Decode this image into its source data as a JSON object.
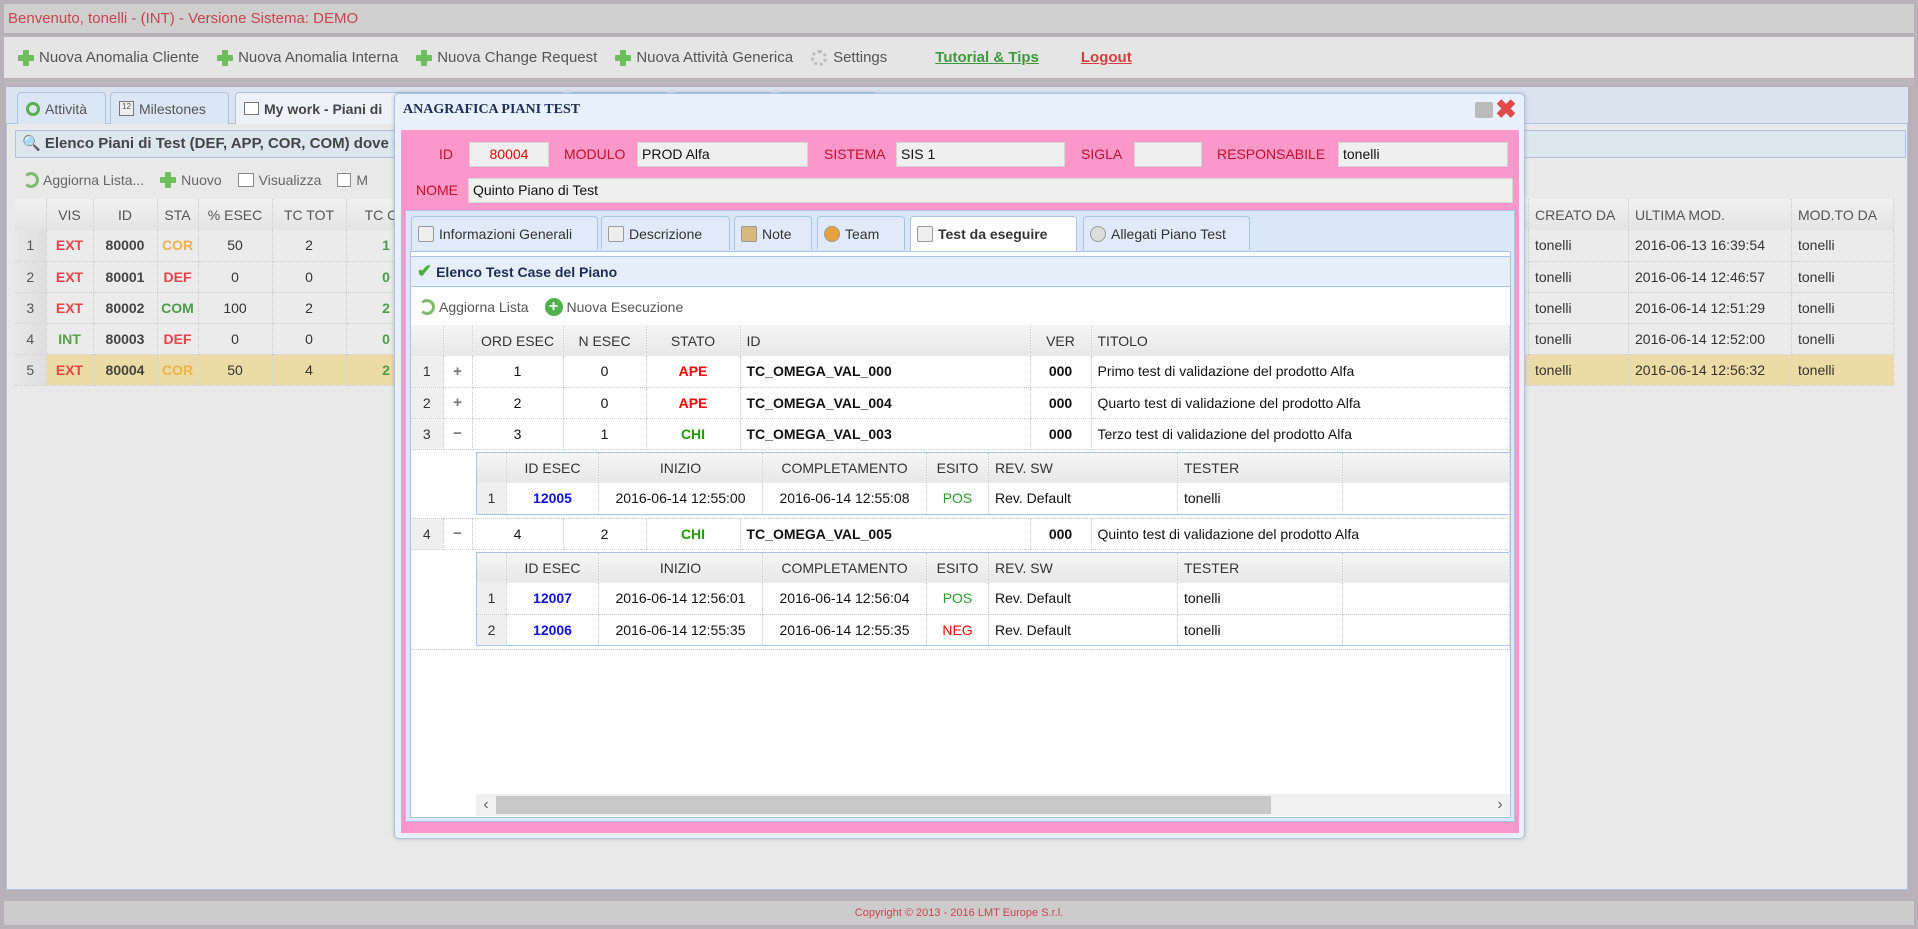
{
  "topbar": {
    "welcome": "Benvenuto, tonelli - (INT) - Versione Sistema: DEMO"
  },
  "toolbar": {
    "items": [
      {
        "label": "Nuova Anomalia Cliente",
        "icon": "plus-icon"
      },
      {
        "label": "Nuova Anomalia Interna",
        "icon": "plus-icon"
      },
      {
        "label": "Nuova Change Request",
        "icon": "plus-icon"
      },
      {
        "label": "Nuova Attività Generica",
        "icon": "plus-icon"
      },
      {
        "label": "Settings",
        "icon": "gear-icon"
      }
    ],
    "tutorial": "Tutorial & Tips",
    "logout": "Logout"
  },
  "tabs": [
    {
      "label": "Attività",
      "icon": "activity-icon"
    },
    {
      "label": "Milestones",
      "icon": "calendar-icon"
    },
    {
      "label": "My work - Piani di",
      "icon": "windows-icon",
      "active": true
    }
  ],
  "list": {
    "header": "Elenco Piani di Test (DEF, APP, COR, COM) dove s",
    "toolbar": [
      "Aggiorna Lista...",
      "Nuovo",
      "Visualizza",
      "M"
    ],
    "columns": [
      "",
      "VIS",
      "ID",
      "STA",
      "% ESEC",
      "TC TOT",
      "TC CH",
      "",
      "CREATO DA",
      "ULTIMA MOD.",
      "MOD.TO DA"
    ],
    "rows": [
      {
        "n": "1",
        "vis": "EXT",
        "id": "80000",
        "sta": "COR",
        "esec": "50",
        "tot": "2",
        "ch": "1",
        "creato": "tonelli",
        "mod": "2016-06-13 16:39:54",
        "modda": "tonelli"
      },
      {
        "n": "2",
        "vis": "EXT",
        "id": "80001",
        "sta": "DEF",
        "esec": "0",
        "tot": "0",
        "ch": "0",
        "creato": "tonelli",
        "mod": "2016-06-14 12:46:57",
        "modda": "tonelli"
      },
      {
        "n": "3",
        "vis": "EXT",
        "id": "80002",
        "sta": "COM",
        "esec": "100",
        "tot": "2",
        "ch": "2",
        "creato": "tonelli",
        "mod": "2016-06-14 12:51:29",
        "modda": "tonelli"
      },
      {
        "n": "4",
        "vis": "INT",
        "id": "80003",
        "sta": "DEF",
        "esec": "0",
        "tot": "0",
        "ch": "0",
        "creato": "tonelli",
        "mod": "2016-06-14 12:52:00",
        "modda": "tonelli"
      },
      {
        "n": "5",
        "vis": "EXT",
        "id": "80004",
        "sta": "COR",
        "esec": "50",
        "tot": "4",
        "ch": "2",
        "creato": "tonelli",
        "mod": "2016-06-14 12:56:32",
        "modda": "tonelli",
        "selected": true
      }
    ]
  },
  "colors": {
    "EXT": "#e8434b",
    "INT": "#5aa04a",
    "COR": "#efb24a",
    "DEF": "#e8434b",
    "COM": "#4a9f4a",
    "APE": "#ff0000",
    "CHI": "#1f9a00",
    "POS": "#2a9a2a",
    "NEG": "#ff0000",
    "id_esec": "#1010e0",
    "pink": "#fc98c9"
  },
  "modal": {
    "title": "ANAGRAFICA PIANI TEST",
    "fields": {
      "id_label": "ID",
      "id": "80004",
      "modulo_label": "MODULO",
      "modulo": "PROD Alfa",
      "sistema_label": "SISTEMA",
      "sistema": "SIS 1",
      "sigla_label": "SIGLA",
      "sigla": "",
      "responsabile_label": "RESPONSABILE",
      "responsabile": "tonelli",
      "nome_label": "NOME",
      "nome": "Quinto Piano di Test"
    },
    "tabs": [
      {
        "label": "Informazioni Generali"
      },
      {
        "label": "Descrizione"
      },
      {
        "label": "Note"
      },
      {
        "label": "Team"
      },
      {
        "label": "Test da eseguire",
        "active": true
      },
      {
        "label": "Allegati Piano Test"
      }
    ],
    "caption": "Elenco Test Case del Piano",
    "actions": {
      "refresh": "Aggiorna Lista",
      "new_exec": "Nuova Esecuzione"
    },
    "columns": [
      "",
      "",
      "ORD ESEC",
      "N ESEC",
      "STATO",
      "ID",
      "VER",
      "TITOLO"
    ],
    "sub_columns": [
      "",
      "ID ESEC",
      "INIZIO",
      "COMPLETAMENTO",
      "ESITO",
      "REV. SW",
      "TESTER"
    ],
    "rows": [
      {
        "n": "1",
        "expanded": false,
        "ord": "1",
        "nesec": "0",
        "stato": "APE",
        "id": "TC_OMEGA_VAL_000",
        "ver": "000",
        "titolo": "Primo test di validazione del prodotto Alfa"
      },
      {
        "n": "2",
        "expanded": false,
        "ord": "2",
        "nesec": "0",
        "stato": "APE",
        "id": "TC_OMEGA_VAL_004",
        "ver": "000",
        "titolo": "Quarto test di validazione del prodotto Alfa"
      },
      {
        "n": "3",
        "expanded": true,
        "ord": "3",
        "nesec": "1",
        "stato": "CHI",
        "id": "TC_OMEGA_VAL_003",
        "ver": "000",
        "titolo": "Terzo test di validazione del prodotto Alfa",
        "executions": [
          {
            "n": "1",
            "id": "12005",
            "inizio": "2016-06-14 12:55:00",
            "fine": "2016-06-14 12:55:08",
            "esito": "POS",
            "rev": "Rev. Default",
            "tester": "tonelli"
          }
        ]
      },
      {
        "n": "4",
        "expanded": true,
        "ord": "4",
        "nesec": "2",
        "stato": "CHI",
        "id": "TC_OMEGA_VAL_005",
        "ver": "000",
        "titolo": "Quinto test di validazione del prodotto Alfa",
        "executions": [
          {
            "n": "1",
            "id": "12007",
            "inizio": "2016-06-14 12:56:01",
            "fine": "2016-06-14 12:56:04",
            "esito": "POS",
            "rev": "Rev. Default",
            "tester": "tonelli"
          },
          {
            "n": "2",
            "id": "12006",
            "inizio": "2016-06-14 12:55:35",
            "fine": "2016-06-14 12:55:35",
            "esito": "NEG",
            "rev": "Rev. Default",
            "tester": "tonelli"
          }
        ]
      }
    ]
  },
  "footer": {
    "copyright": "Copyright © 2013 - 2016 LMT Europe S.r.l."
  }
}
